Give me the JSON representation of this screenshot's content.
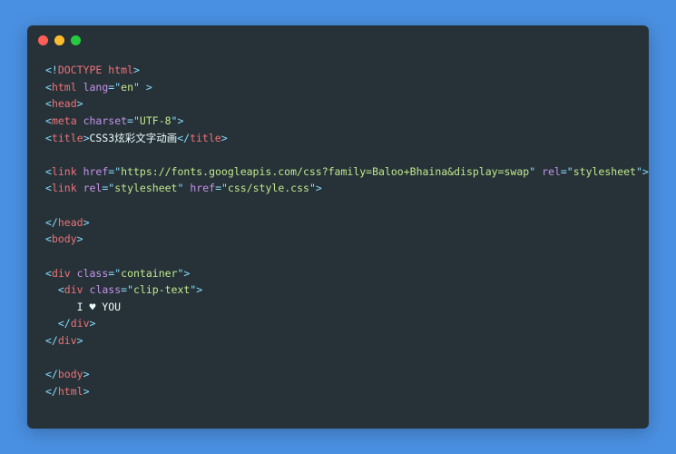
{
  "code": {
    "line1": {
      "p1": "<!",
      "tag": "DOCTYPE html",
      "p2": ">"
    },
    "line2": {
      "p1": "<",
      "tag": "html",
      "sp": " ",
      "attr": "lang",
      "eq": "=",
      "q1": "\"",
      "val": "en",
      "q2": "\"",
      "tail": " >"
    },
    "line3": {
      "p1": "<",
      "tag": "head",
      "p2": ">"
    },
    "line4": {
      "p1": "<",
      "tag": "meta",
      "sp": " ",
      "attr": "charset",
      "eq": "=",
      "q1": "\"",
      "val": "UTF-8",
      "q2": "\"",
      "p2": ">"
    },
    "line5": {
      "p1": "<",
      "tag": "title",
      "p2": ">",
      "text": "CSS3炫彩文字动画",
      "p3": "</",
      "tag2": "title",
      "p4": ">"
    },
    "line6": "",
    "line7": {
      "p1": "<",
      "tag": "link",
      "sp": " ",
      "a1": "href",
      "eq1": "=",
      "q1": "\"",
      "v1": "https://fonts.googleapis.com/css?family=Baloo+Bhaina&display=swap",
      "q2": "\"",
      "sp2": " ",
      "a2": "rel",
      "eq2": "=",
      "q3": "\"",
      "v2": "stylesheet",
      "q4": "\"",
      "p2": ">"
    },
    "line8": {
      "p1": "<",
      "tag": "link",
      "sp": " ",
      "a1": "rel",
      "eq1": "=",
      "q1": "\"",
      "v1": "stylesheet",
      "q2": "\"",
      "sp2": " ",
      "a2": "href",
      "eq2": "=",
      "q3": "\"",
      "v2": "css/style.css",
      "q4": "\"",
      "p2": ">"
    },
    "line9": "",
    "line10": {
      "p1": "</",
      "tag": "head",
      "p2": ">"
    },
    "line11": {
      "p1": "<",
      "tag": "body",
      "p2": ">"
    },
    "line12": "",
    "line13": {
      "p1": "<",
      "tag": "div",
      "sp": " ",
      "attr": "class",
      "eq": "=",
      "q1": "\"",
      "val": "container",
      "q2": "\"",
      "p2": ">"
    },
    "line14": {
      "ind": "  ",
      "p1": "<",
      "tag": "div",
      "sp": " ",
      "attr": "class",
      "eq": "=",
      "q1": "\"",
      "val": "clip-text",
      "q2": "\"",
      "p2": ">"
    },
    "line15": {
      "text": "     I ♥ YOU"
    },
    "line16": {
      "ind": "  ",
      "p1": "</",
      "tag": "div",
      "p2": ">"
    },
    "line17": {
      "p1": "</",
      "tag": "div",
      "p2": ">"
    },
    "line18": "",
    "line19": {
      "p1": "</",
      "tag": "body",
      "p2": ">"
    },
    "line20": {
      "p1": "</",
      "tag": "html",
      "p2": ">"
    }
  }
}
